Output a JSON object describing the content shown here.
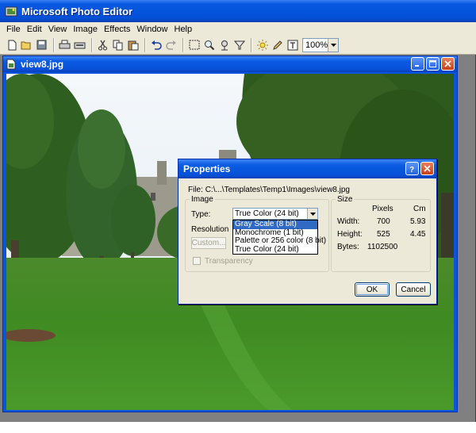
{
  "app": {
    "title": "Microsoft Photo Editor",
    "menu": [
      "File",
      "Edit",
      "View",
      "Image",
      "Effects",
      "Window",
      "Help"
    ],
    "zoom": "100%"
  },
  "document": {
    "title": "view8.jpg"
  },
  "dialog": {
    "title": "Properties",
    "file_label": "File:",
    "file_path": "C:\\...\\Templates\\Temp1\\Images\\view8.jpg",
    "image_group": "Image",
    "type_label": "Type:",
    "type_value": "True Color (24 bit)",
    "type_options": [
      "Gray Scale (8 bit)",
      "Monochrome (1 bit)",
      "Palette or 256 color (8 bit)",
      "True Color (24 bit)"
    ],
    "resolution_label": "Resolution",
    "custom_button": "Custom...",
    "transparency_label": "Transparency",
    "size_group": "Size",
    "col_pixels": "Pixels",
    "col_cm": "Cm",
    "width_label": "Width:",
    "width_px": "700",
    "width_cm": "5.93",
    "height_label": "Height:",
    "height_px": "525",
    "height_cm": "4.45",
    "bytes_label": "Bytes:",
    "bytes_value": "1102500",
    "ok": "OK",
    "cancel": "Cancel"
  }
}
